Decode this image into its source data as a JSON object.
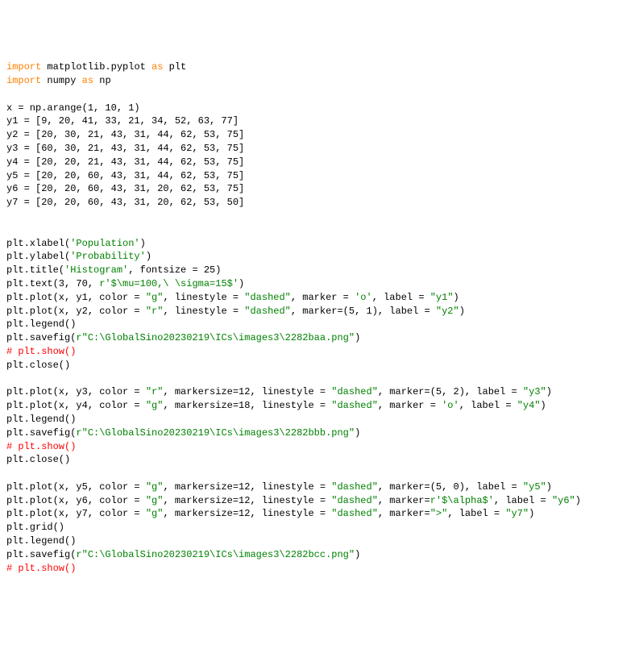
{
  "lines": [
    [
      {
        "t": "import",
        "c": "kw-orange"
      },
      {
        "t": " matplotlib.pyplot ",
        "c": "plain"
      },
      {
        "t": "as",
        "c": "kw-orange"
      },
      {
        "t": " plt",
        "c": "plain"
      }
    ],
    [
      {
        "t": "import",
        "c": "kw-orange"
      },
      {
        "t": " numpy ",
        "c": "plain"
      },
      {
        "t": "as",
        "c": "kw-orange"
      },
      {
        "t": " np",
        "c": "plain"
      }
    ],
    [
      {
        "t": "",
        "c": "plain"
      }
    ],
    [
      {
        "t": "x = np.arange(1, 10, 1)",
        "c": "plain"
      }
    ],
    [
      {
        "t": "y1 = [9, 20, 41, 33, 21, 34, 52, 63, 77]",
        "c": "plain"
      }
    ],
    [
      {
        "t": "y2 = [20, 30, 21, 43, 31, 44, 62, 53, 75]",
        "c": "plain"
      }
    ],
    [
      {
        "t": "y3 = [60, 30, 21, 43, 31, 44, 62, 53, 75]",
        "c": "plain"
      }
    ],
    [
      {
        "t": "y4 = [20, 20, 21, 43, 31, 44, 62, 53, 75]",
        "c": "plain"
      }
    ],
    [
      {
        "t": "y5 = [20, 20, 60, 43, 31, 44, 62, 53, 75]",
        "c": "plain"
      }
    ],
    [
      {
        "t": "y6 = [20, 20, 60, 43, 31, 20, 62, 53, 75]",
        "c": "plain"
      }
    ],
    [
      {
        "t": "y7 = [20, 20, 60, 43, 31, 20, 62, 53, 50]",
        "c": "plain"
      }
    ],
    [
      {
        "t": "",
        "c": "plain"
      }
    ],
    [
      {
        "t": "",
        "c": "plain"
      }
    ],
    [
      {
        "t": "plt.xlabel(",
        "c": "plain"
      },
      {
        "t": "'Population'",
        "c": "kw-green"
      },
      {
        "t": ")",
        "c": "plain"
      }
    ],
    [
      {
        "t": "plt.ylabel(",
        "c": "plain"
      },
      {
        "t": "'Probability'",
        "c": "kw-green"
      },
      {
        "t": ")",
        "c": "plain"
      }
    ],
    [
      {
        "t": "plt.title(",
        "c": "plain"
      },
      {
        "t": "'Histogram'",
        "c": "kw-green"
      },
      {
        "t": ", fontsize = 25)",
        "c": "plain"
      }
    ],
    [
      {
        "t": "plt.text(3, 70, ",
        "c": "plain"
      },
      {
        "t": "r'$\\mu=100,\\ \\sigma=15$'",
        "c": "kw-green"
      },
      {
        "t": ")",
        "c": "plain"
      }
    ],
    [
      {
        "t": "plt.plot(x, y1, color = ",
        "c": "plain"
      },
      {
        "t": "\"g\"",
        "c": "kw-green"
      },
      {
        "t": ", linestyle = ",
        "c": "plain"
      },
      {
        "t": "\"dashed\"",
        "c": "kw-green"
      },
      {
        "t": ", marker = ",
        "c": "plain"
      },
      {
        "t": "'o'",
        "c": "kw-green"
      },
      {
        "t": ", label = ",
        "c": "plain"
      },
      {
        "t": "\"y1\"",
        "c": "kw-green"
      },
      {
        "t": ")",
        "c": "plain"
      }
    ],
    [
      {
        "t": "plt.plot(x, y2, color = ",
        "c": "plain"
      },
      {
        "t": "\"r\"",
        "c": "kw-green"
      },
      {
        "t": ", linestyle = ",
        "c": "plain"
      },
      {
        "t": "\"dashed\"",
        "c": "kw-green"
      },
      {
        "t": ", marker=(5, 1), label = ",
        "c": "plain"
      },
      {
        "t": "\"y2\"",
        "c": "kw-green"
      },
      {
        "t": ")",
        "c": "plain"
      }
    ],
    [
      {
        "t": "plt.legend()",
        "c": "plain"
      }
    ],
    [
      {
        "t": "plt.savefig(",
        "c": "plain"
      },
      {
        "t": "r\"C:\\GlobalSino20230219\\ICs\\images3\\2282baa.png\"",
        "c": "kw-green"
      },
      {
        "t": ")",
        "c": "plain"
      }
    ],
    [
      {
        "t": "# plt.show()",
        "c": "kw-red"
      }
    ],
    [
      {
        "t": "plt.close()",
        "c": "plain"
      }
    ],
    [
      {
        "t": "",
        "c": "plain"
      }
    ],
    [
      {
        "t": "plt.plot(x, y3, color = ",
        "c": "plain"
      },
      {
        "t": "\"r\"",
        "c": "kw-green"
      },
      {
        "t": ", markersize=12, linestyle = ",
        "c": "plain"
      },
      {
        "t": "\"dashed\"",
        "c": "kw-green"
      },
      {
        "t": ", marker=(5, 2), label = ",
        "c": "plain"
      },
      {
        "t": "\"y3\"",
        "c": "kw-green"
      },
      {
        "t": ")",
        "c": "plain"
      }
    ],
    [
      {
        "t": "plt.plot(x, y4, color = ",
        "c": "plain"
      },
      {
        "t": "\"g\"",
        "c": "kw-green"
      },
      {
        "t": ", markersize=18, linestyle = ",
        "c": "plain"
      },
      {
        "t": "\"dashed\"",
        "c": "kw-green"
      },
      {
        "t": ", marker = ",
        "c": "plain"
      },
      {
        "t": "'o'",
        "c": "kw-green"
      },
      {
        "t": ", label = ",
        "c": "plain"
      },
      {
        "t": "\"y4\"",
        "c": "kw-green"
      },
      {
        "t": ")",
        "c": "plain"
      }
    ],
    [
      {
        "t": "plt.legend()",
        "c": "plain"
      }
    ],
    [
      {
        "t": "plt.savefig(",
        "c": "plain"
      },
      {
        "t": "r\"C:\\GlobalSino20230219\\ICs\\images3\\2282bbb.png\"",
        "c": "kw-green"
      },
      {
        "t": ")",
        "c": "plain"
      }
    ],
    [
      {
        "t": "# plt.show()",
        "c": "kw-red"
      }
    ],
    [
      {
        "t": "plt.close()",
        "c": "plain"
      }
    ],
    [
      {
        "t": "",
        "c": "plain"
      }
    ],
    [
      {
        "t": "plt.plot(x, y5, color = ",
        "c": "plain"
      },
      {
        "t": "\"g\"",
        "c": "kw-green"
      },
      {
        "t": ", markersize=12, linestyle = ",
        "c": "plain"
      },
      {
        "t": "\"dashed\"",
        "c": "kw-green"
      },
      {
        "t": ", marker=(5, 0), label = ",
        "c": "plain"
      },
      {
        "t": "\"y5\"",
        "c": "kw-green"
      },
      {
        "t": ")",
        "c": "plain"
      }
    ],
    [
      {
        "t": "plt.plot(x, y6, color = ",
        "c": "plain"
      },
      {
        "t": "\"g\"",
        "c": "kw-green"
      },
      {
        "t": ", markersize=12, linestyle = ",
        "c": "plain"
      },
      {
        "t": "\"dashed\"",
        "c": "kw-green"
      },
      {
        "t": ", marker=",
        "c": "plain"
      },
      {
        "t": "r'$\\alpha$'",
        "c": "kw-green"
      },
      {
        "t": ", label = ",
        "c": "plain"
      },
      {
        "t": "\"y6\"",
        "c": "kw-green"
      },
      {
        "t": ")",
        "c": "plain"
      }
    ],
    [
      {
        "t": "plt.plot(x, y7, color = ",
        "c": "plain"
      },
      {
        "t": "\"g\"",
        "c": "kw-green"
      },
      {
        "t": ", markersize=12, linestyle = ",
        "c": "plain"
      },
      {
        "t": "\"dashed\"",
        "c": "kw-green"
      },
      {
        "t": ", marker=",
        "c": "plain"
      },
      {
        "t": "\">\"",
        "c": "kw-green"
      },
      {
        "t": ", label = ",
        "c": "plain"
      },
      {
        "t": "\"y7\"",
        "c": "kw-green"
      },
      {
        "t": ")",
        "c": "plain"
      }
    ],
    [
      {
        "t": "plt.grid()",
        "c": "plain"
      }
    ],
    [
      {
        "t": "plt.legend()",
        "c": "plain"
      }
    ],
    [
      {
        "t": "plt.savefig(",
        "c": "plain"
      },
      {
        "t": "r\"C:\\GlobalSino20230219\\ICs\\images3\\2282bcc.png\"",
        "c": "kw-green"
      },
      {
        "t": ")",
        "c": "plain"
      }
    ],
    [
      {
        "t": "# plt.show()",
        "c": "kw-red"
      }
    ]
  ]
}
